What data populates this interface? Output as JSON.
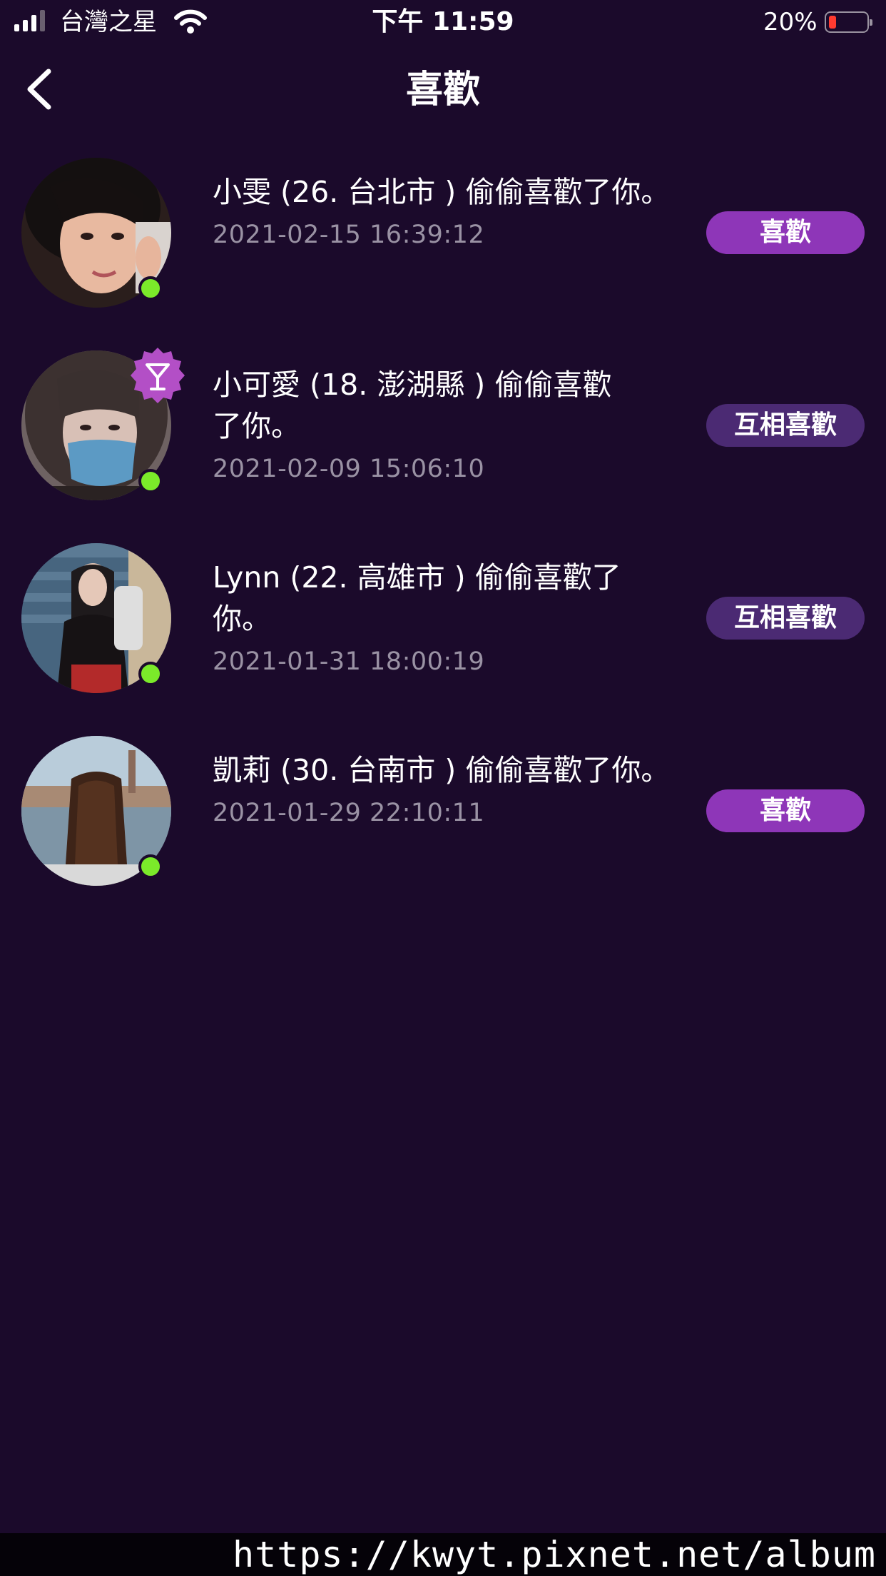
{
  "status_bar": {
    "carrier": "台灣之星",
    "time": "下午 11:59",
    "battery": "20%",
    "signal_icon": "cellular-signal-icon",
    "wifi_icon": "wifi-icon",
    "battery_icon": "battery-low-icon"
  },
  "nav": {
    "title": "喜歡",
    "back_icon": "chevron-left-icon"
  },
  "likes": [
    {
      "message": "小雯 (26. 台北市 ) 偷偷喜歡了你。",
      "time": "2021-02-15 16:39:12",
      "button": "喜歡",
      "online": true,
      "avatar_color": "#3a2b2a"
    },
    {
      "message": "小可愛 (18. 澎湖縣 ) 偷偷喜歡了你。",
      "time": "2021-02-09 15:06:10",
      "button": "互相喜歡",
      "online": true,
      "vip_icon": "cocktail-badge-icon",
      "avatar_color": "#8a7a7a"
    },
    {
      "message": "Lynn (22. 高雄市 ) 偷偷喜歡了你。",
      "time": "2021-01-31 18:00:19",
      "button": "互相喜歡",
      "online": true,
      "avatar_color": "#4a6a85"
    },
    {
      "message": "凱莉 (30. 台南市 ) 偷偷喜歡了你。",
      "time": "2021-01-29 22:10:11",
      "button": "喜歡",
      "online": true,
      "avatar_color": "#8fa6b8"
    }
  ],
  "colors": {
    "background": "#1b0a2b",
    "like_button": "#8e36b8",
    "mutual_button": "#4b2a73",
    "online_dot": "#7bea2a",
    "timestamp": "#9a92a4"
  },
  "watermark": "https://kwyt.pixnet.net/album"
}
